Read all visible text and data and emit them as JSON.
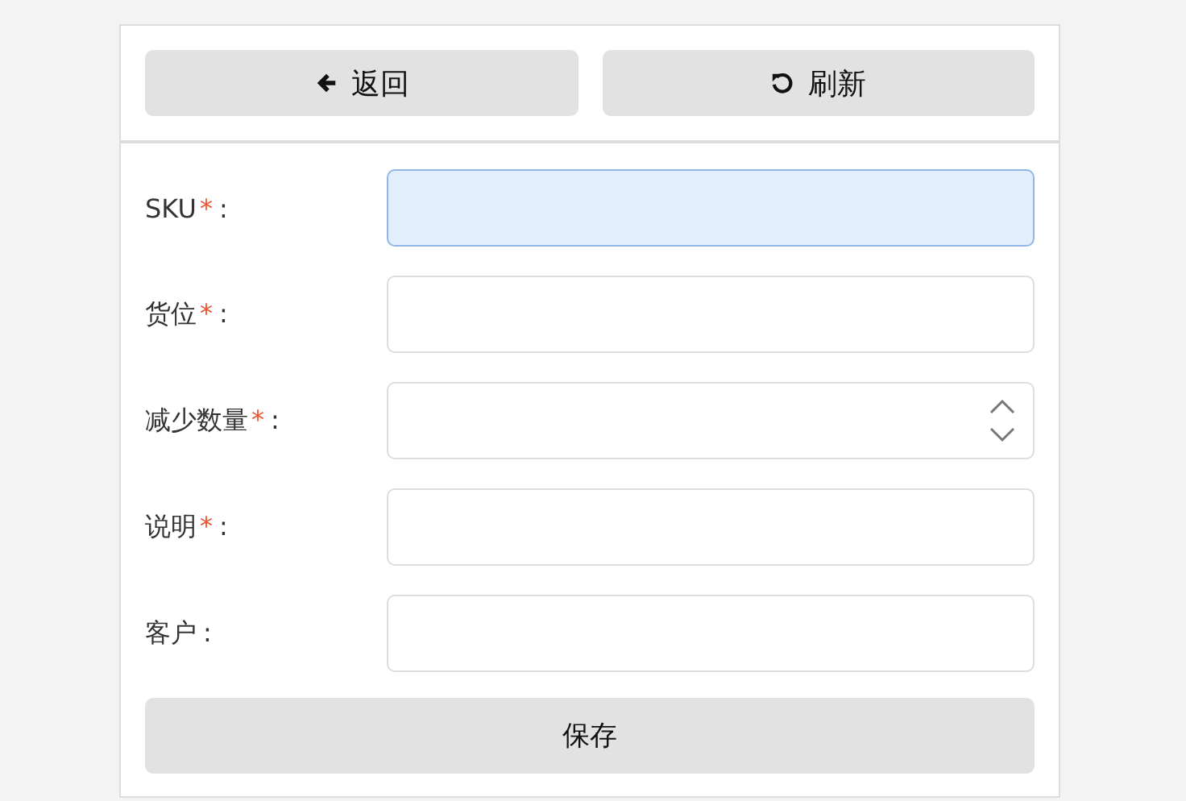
{
  "toolbar": [
    {
      "kind": "back",
      "label": "返回"
    },
    {
      "kind": "refresh",
      "label": "刷新"
    }
  ],
  "fields": [
    {
      "label": "SKU",
      "required_mark": "*",
      "colon": ":",
      "kind": "text",
      "focused": true
    },
    {
      "label": "货位",
      "required_mark": "*",
      "colon": ":",
      "kind": "text",
      "focused": false
    },
    {
      "label": "减少数量",
      "required_mark": "*",
      "colon": ":",
      "kind": "number",
      "focused": false
    },
    {
      "label": "说明",
      "required_mark": "*",
      "colon": ":",
      "kind": "text",
      "focused": false
    },
    {
      "label": "客户",
      "colon": ":",
      "kind": "text",
      "focused": false
    }
  ],
  "save_button": "保存"
}
